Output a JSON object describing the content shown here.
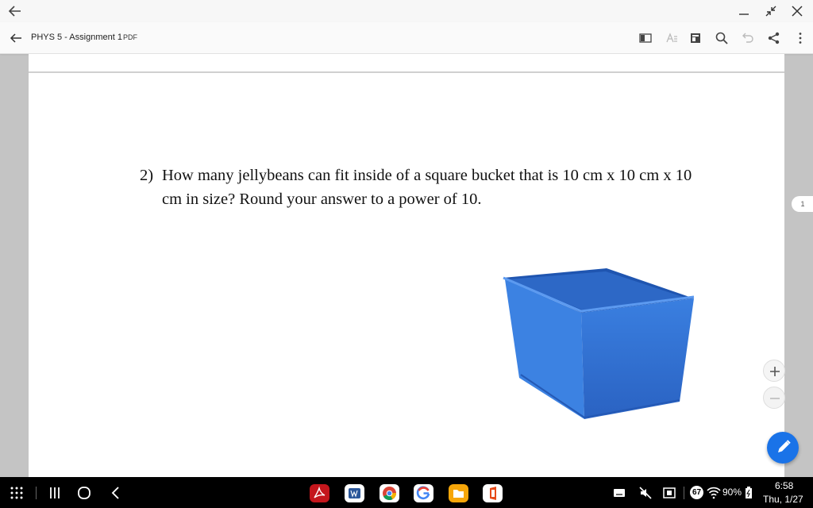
{
  "window": {
    "back_icon": "arrow-left-icon",
    "controls": [
      "minimize-icon",
      "restore-icon",
      "close-icon"
    ]
  },
  "toolbar": {
    "title": "PHYS 5 - Assignment 1",
    "file_type": "PDF",
    "icons": [
      "reading-mode-icon",
      "text-recognition-icon",
      "bookmark-icon",
      "search-icon",
      "undo-icon",
      "share-icon",
      "more-vert-icon"
    ]
  },
  "document": {
    "question_number": "2)",
    "question_text": "How many jellybeans can fit inside of a square bucket that is 10 cm x 10 cm x 10 cm in size?  Round your answer to a power of 10.",
    "image": "blue-bucket-image",
    "page_indicator": "1"
  },
  "controls": {
    "zoom_in": "+",
    "zoom_out": "−",
    "edit_icon": "pencil-icon"
  },
  "taskbar": {
    "nav": [
      "apps-grid-icon",
      "recents-icon",
      "home-icon",
      "back-icon"
    ],
    "apps": [
      "acrobat-icon",
      "word-icon",
      "chrome-icon",
      "google-icon",
      "files-icon",
      "office-icon"
    ],
    "badge": "67",
    "battery": "90%",
    "time": "6:58",
    "date": "Thu, 1/27"
  },
  "colors": {
    "accent": "#1a73e8",
    "bucket": "#2f6fd4",
    "taskbar": "#000000"
  }
}
